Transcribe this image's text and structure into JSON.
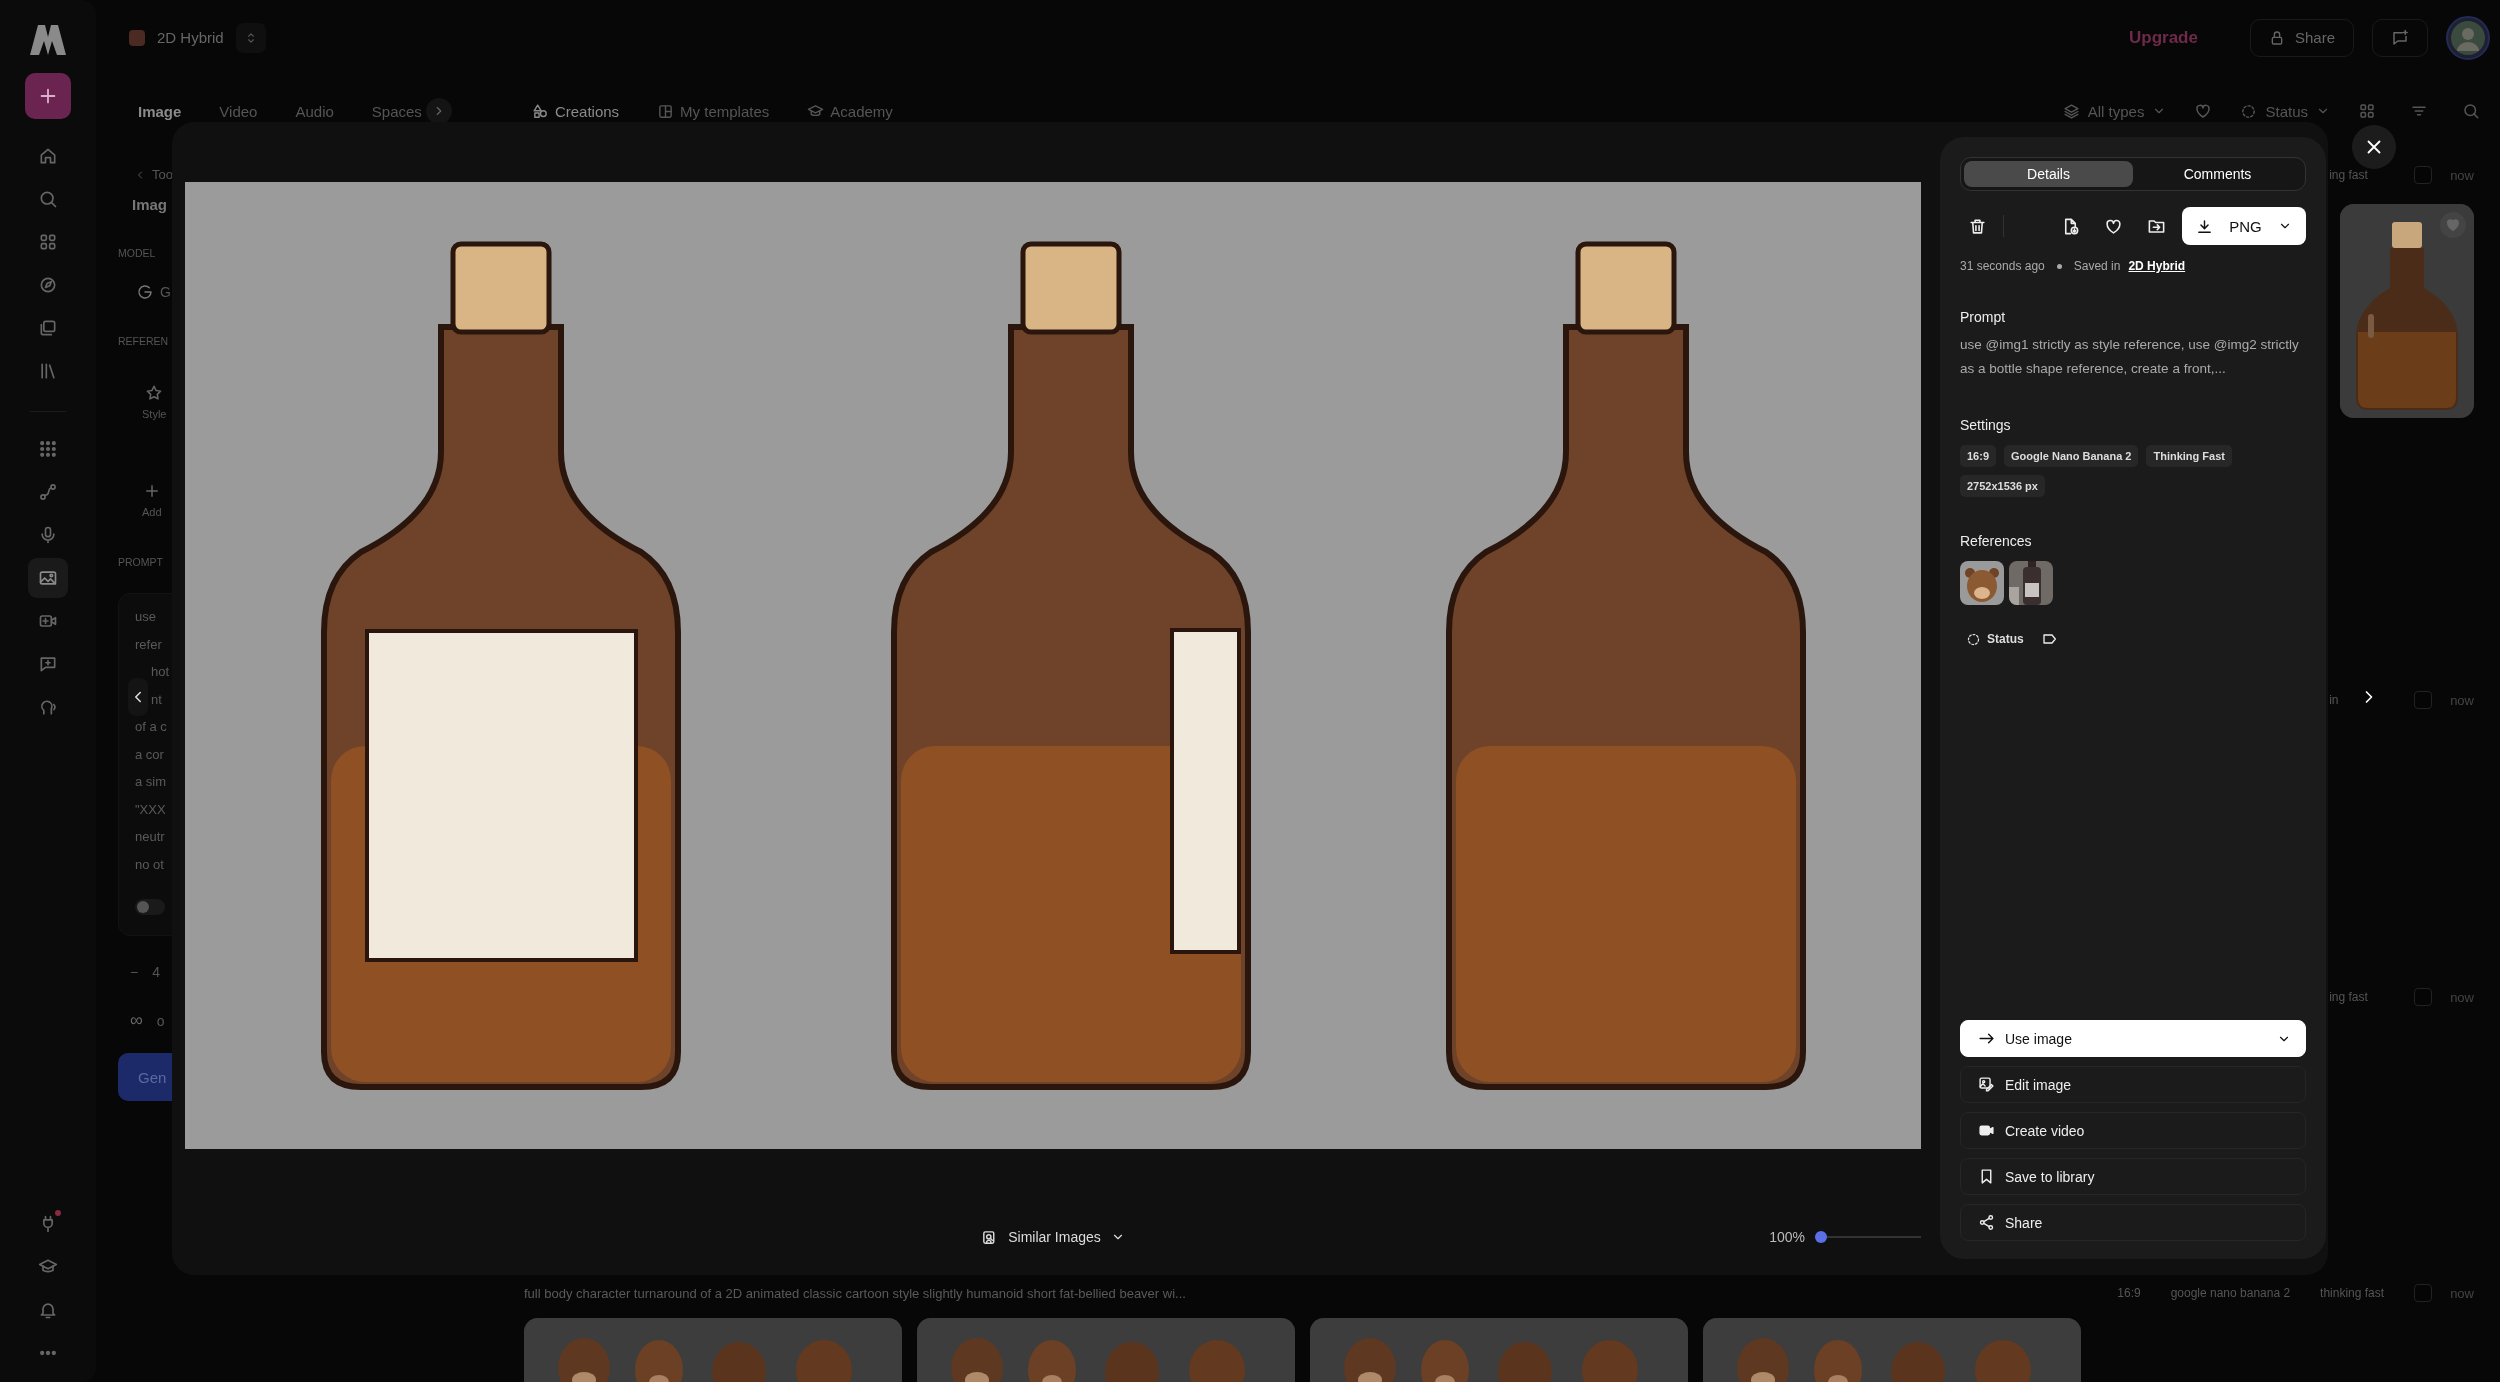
{
  "rail": {
    "items": [
      {
        "selected": false
      },
      {
        "selected": false
      },
      {
        "selected": false
      },
      {
        "selected": false
      },
      {
        "selected": false
      },
      {
        "selected": false
      }
    ],
    "tools": [
      {
        "selected": false
      },
      {
        "selected": false
      },
      {
        "selected": false
      },
      {
        "selected": true
      },
      {
        "selected": false
      },
      {
        "selected": false
      },
      {
        "selected": false
      }
    ],
    "bottom": [
      {
        "badge": true
      },
      {
        "badge": false
      },
      {
        "badge": false
      },
      {
        "badge": false
      }
    ]
  },
  "header": {
    "project": "2D Hybrid",
    "upgrade": "Upgrade",
    "share": "Share"
  },
  "tabs": [
    {
      "label": "Image",
      "selected": true
    },
    {
      "label": "Video",
      "selected": false
    },
    {
      "label": "Audio",
      "selected": false
    },
    {
      "label": "Spaces",
      "selected": false
    }
  ],
  "nav": [
    {
      "label": "Creations",
      "selected": true
    },
    {
      "label": "My templates",
      "selected": false
    },
    {
      "label": "Academy",
      "selected": false
    }
  ],
  "filters": {
    "type": "All types",
    "status": "Status"
  },
  "left_panel": {
    "back": "Too",
    "title": "Imag",
    "model_heading": "MODEL",
    "model": "G",
    "references_heading": "REFEREN",
    "reference_slots": [
      "Style",
      "Add"
    ],
    "prompt_heading": "PROMPT",
    "prompt_lines": [
      "use",
      "refer",
      "hot",
      "nt",
      "of a c",
      "a cor",
      "a sim",
      "\"XXX",
      "neutr",
      "no ot"
    ],
    "toggle_on": false,
    "count_minus": "−",
    "count": "4",
    "infinity": "∞",
    "option": "o",
    "generate": "Gen"
  },
  "viewer": {
    "similar": "Similar Images",
    "zoom": "100%",
    "zoom_slider": {
      "level": 0
    }
  },
  "details": {
    "tabs": [
      {
        "label": "Details",
        "selected": true
      },
      {
        "label": "Comments",
        "selected": false
      }
    ],
    "format": "PNG",
    "time": "31 seconds ago",
    "saved_label": "Saved in",
    "saved_link": "2D Hybrid",
    "prompt_heading": "Prompt",
    "prompt": "use @img1 strictly as style reference, use @img2 strictly as a bottle shape reference, create a front,...",
    "settings_heading": "Settings",
    "settings": [
      "16:9",
      "Google Nano Banana 2",
      "Thinking Fast",
      "2752x1536 px"
    ],
    "references_heading": "References",
    "references": [
      {
        "kind": "picture"
      },
      {
        "kind": "picture"
      }
    ],
    "status": "Status",
    "actions": [
      {
        "label": "Use image",
        "kind": "primary"
      },
      {
        "label": "Edit image",
        "kind": "edit"
      },
      {
        "label": "Create video",
        "kind": "video"
      },
      {
        "label": "Save to library",
        "kind": "save"
      },
      {
        "label": "Share",
        "kind": "share"
      }
    ]
  },
  "gallery": {
    "generations": [
      {
        "tags": [
          "ing fast"
        ],
        "time": "now",
        "checked": false,
        "cards": [
          {
            "kind": "picture"
          }
        ]
      },
      {
        "tags": [
          "in"
        ],
        "time": "now",
        "checked": false
      },
      {
        "tags": [
          "ing fast"
        ],
        "time": "now",
        "checked": false
      },
      {
        "caption": "full body character turnaround of a 2D animated classic cartoon style slightly humanoid short fat-bellied beaver wi...",
        "tags": [
          "16:9",
          "google nano banana 2",
          "thinking fast"
        ],
        "time": "now",
        "checked": false,
        "cards": [
          {
            "kind": "picture"
          },
          {
            "kind": "picture"
          },
          {
            "kind": "picture"
          },
          {
            "kind": "picture"
          }
        ]
      }
    ]
  }
}
